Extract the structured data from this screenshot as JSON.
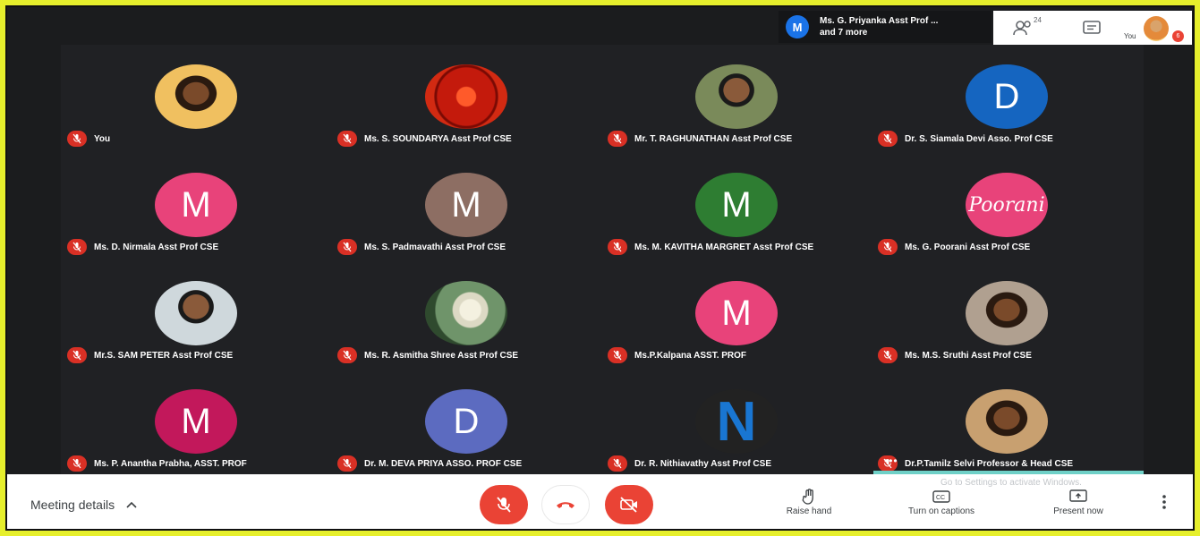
{
  "header": {
    "presenter_initial": "M",
    "presenter_line1": "Ms. G. Priyanka Asst Prof ...",
    "presenter_line2": "and 7 more",
    "people_count": "24",
    "you_label": "You",
    "notification_count": "6"
  },
  "tiles": [
    {
      "name": "You",
      "avatar_type": "photo-woman",
      "color": "#f0c060"
    },
    {
      "name": "Ms. S. SOUNDARYA Asst Prof CSE",
      "avatar_type": "photo-flower-red",
      "color": "#c41a0c"
    },
    {
      "name": "Mr. T. RAGHUNATHAN Asst Prof CSE",
      "avatar_type": "photo-man",
      "color": "#7a8a5a"
    },
    {
      "name": "Dr. S. Siamala Devi Asso. Prof CSE",
      "avatar_type": "initial",
      "initial": "D",
      "color": "#1565c0"
    },
    {
      "name": "Ms. D. Nirmala Asst Prof CSE",
      "avatar_type": "initial",
      "initial": "M",
      "color": "#e8437a"
    },
    {
      "name": "Ms. S. Padmavathi Asst Prof CSE",
      "avatar_type": "initial",
      "initial": "M",
      "color": "#8d6e63"
    },
    {
      "name": "Ms. M. KAVITHA MARGRET Asst Prof CSE",
      "avatar_type": "initial",
      "initial": "M",
      "color": "#2e7d32"
    },
    {
      "name": "Ms. G. Poorani Asst Prof CSE",
      "avatar_type": "text",
      "initial": "Poorani",
      "color": "#e8437a"
    },
    {
      "name": "Mr.S. SAM PETER Asst Prof CSE",
      "avatar_type": "photo-man2",
      "color": "#cfd8dc"
    },
    {
      "name": "Ms. R. Asmitha Shree Asst Prof CSE",
      "avatar_type": "photo-flower-white",
      "color": "#5b7d5b"
    },
    {
      "name": "Ms.P.Kalpana ASST. PROF",
      "avatar_type": "initial",
      "initial": "M",
      "color": "#e8437a"
    },
    {
      "name": "Ms. M.S. Sruthi Asst Prof CSE",
      "avatar_type": "photo-woman2",
      "color": "#b0a090"
    },
    {
      "name": "Ms. P. Anantha Prabha, ASST. PROF",
      "avatar_type": "initial",
      "initial": "M",
      "color": "#c2185b"
    },
    {
      "name": "Dr. M. DEVA PRIYA ASSO. PROF CSE",
      "avatar_type": "initial",
      "initial": "D",
      "color": "#5c6bc0"
    },
    {
      "name": "Dr. R. Nithiavathy Asst Prof CSE",
      "avatar_type": "letter-n",
      "initial": "N",
      "color": "#1976d2"
    },
    {
      "name": "Dr.P.Tamilz Selvi Professor & Head CSE",
      "avatar_type": "photo-woman3",
      "color": "#c8a070"
    }
  ],
  "bottom": {
    "meeting_details": "Meeting details",
    "raise_hand": "Raise hand",
    "captions": "Turn on captions",
    "present_now": "Present now",
    "watermark": "Go to Settings to activate Windows."
  }
}
